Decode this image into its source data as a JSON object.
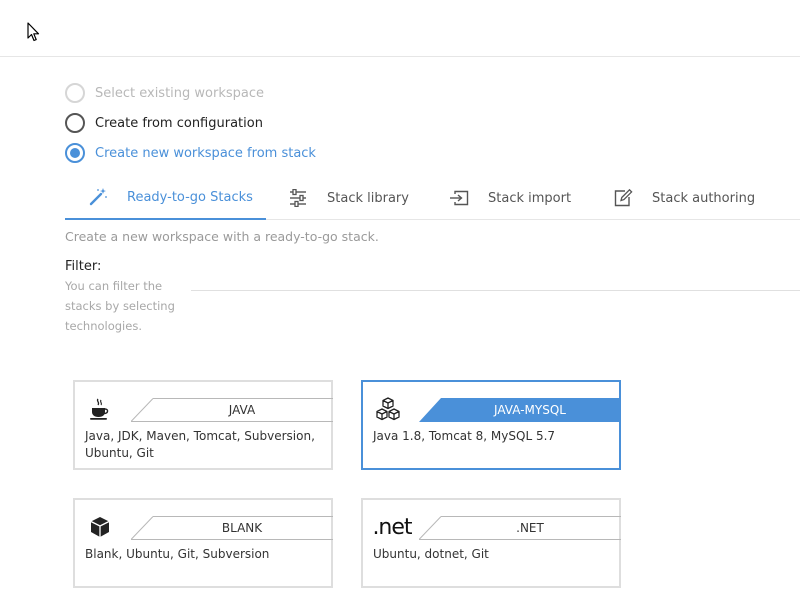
{
  "workspace_source": {
    "options": [
      {
        "label": "Select existing workspace",
        "state": "disabled"
      },
      {
        "label": "Create from configuration",
        "state": "unchecked"
      },
      {
        "label": "Create new workspace from stack",
        "state": "checked"
      }
    ]
  },
  "tabs": [
    {
      "label": "Ready-to-go Stacks",
      "icon": "magic-wand-icon",
      "active": true
    },
    {
      "label": "Stack library",
      "icon": "sliders-icon",
      "active": false
    },
    {
      "label": "Stack import",
      "icon": "import-icon",
      "active": false
    },
    {
      "label": "Stack authoring",
      "icon": "edit-icon",
      "active": false
    }
  ],
  "description": "Create a new workspace with a ready-to-go stack.",
  "filter": {
    "label": "Filter:",
    "help": "You can filter the stacks by selecting technologies."
  },
  "stacks": [
    {
      "title": "JAVA",
      "description": "Java, JDK, Maven, Tomcat, Subversion, Ubuntu, Git",
      "icon": "java-cup-icon",
      "selected": false
    },
    {
      "title": "JAVA-MYSQL",
      "description": "Java 1.8, Tomcat 8, MySQL 5.7",
      "icon": "cubes-icon",
      "selected": true
    },
    {
      "title": "BLANK",
      "description": "Blank, Ubuntu, Git, Subversion",
      "icon": "cube-icon",
      "selected": false
    },
    {
      "title": ".NET",
      "description": "Ubuntu, dotnet, Git",
      "icon": "dotnet-icon",
      "icon_text": ".net",
      "selected": false
    }
  ],
  "colors": {
    "accent": "#4a90d9",
    "border": "#dedede",
    "muted_text": "#9a9a9a"
  }
}
